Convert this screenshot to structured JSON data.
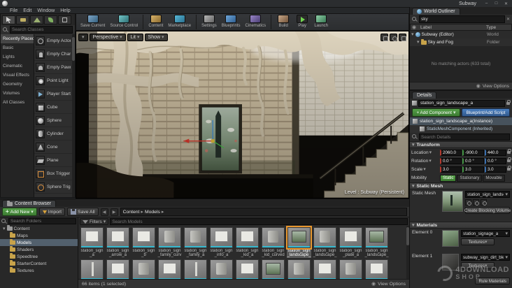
{
  "window": {
    "title": "Subway",
    "menu": [
      "File",
      "Edit",
      "Window",
      "Help"
    ]
  },
  "toolbar": {
    "buttons": [
      "Save Current",
      "Source Control",
      "Content",
      "Marketplace",
      "Settings",
      "Blueprints",
      "Cinematics",
      "Build",
      "Play",
      "Launch"
    ]
  },
  "modes": {
    "search_placeholder": "Search Classes",
    "categories": [
      "Recently Placed",
      "Basic",
      "Lights",
      "Cinematic",
      "Visual Effects",
      "Geometry",
      "Volumes",
      "All Classes"
    ],
    "items": [
      "Empty Actor",
      "Empty Chara",
      "Empty Pawn",
      "Point Light",
      "Player Start",
      "Cube",
      "Sphere",
      "Cylinder",
      "Cone",
      "Plane",
      "Box Trigger",
      "Sphere Trig"
    ]
  },
  "viewport": {
    "camera_mode": "Perspective",
    "view_mode": "Lit",
    "show_menu": "Show",
    "level_label": "Level : Subway (Persistent)"
  },
  "world_outliner": {
    "tab": "World Outliner",
    "search_value": "sky",
    "columns": {
      "label": "Label",
      "type": "Type"
    },
    "rows": [
      {
        "label": "Subway (Editor)",
        "type": "World"
      },
      {
        "label": "Sky and Fog",
        "type": "Folder"
      }
    ],
    "empty_message": "No matching actors (633 total)",
    "view_options": "View Options"
  },
  "details": {
    "tab": "Details",
    "actor_name": "station_sign_landscape_a",
    "add_component": "+ Add Component",
    "blueprint_button": "Blueprint/Add Script",
    "instance_row": "station_sign_landscape_a(Instance)",
    "component_row": "StaticMeshComponent (Inherited)",
    "search_placeholder": "Search Details",
    "transform": {
      "header": "Transform",
      "rows": [
        {
          "label": "Location",
          "x": "2060.0",
          "y": "-900.0",
          "z": "440.0"
        },
        {
          "label": "Rotation",
          "x": "0.0 °",
          "y": "0.0 °",
          "z": "0.0 °"
        },
        {
          "label": "Scale",
          "x": "3.0",
          "y": "3.0",
          "z": "3.0"
        }
      ],
      "mobility_label": "Mobility",
      "mobility": [
        "Static",
        "Stationary",
        "Movable"
      ],
      "mobility_selected": "Static"
    },
    "static_mesh": {
      "header": "Static Mesh",
      "label": "Static Mesh",
      "value": "station_sign_landscape_a",
      "create_blocking_volume": "Create Blocking Volume"
    },
    "materials": {
      "header": "Materials",
      "elements": [
        {
          "label": "Element 0",
          "value": "station_signage_a",
          "textures_button": "Textures"
        },
        {
          "label": "Element 1",
          "value": "subway_sign_dirt_blend",
          "textures_button": "Textures"
        }
      ],
      "rule_materials": "Rule Materials"
    }
  },
  "content_browser": {
    "tab": "Content Browser",
    "add_new": "Add New",
    "import": "Import",
    "save_all": "Save All",
    "breadcrumb": [
      "Content",
      "Models"
    ],
    "folder_search_placeholder": "Search Folders",
    "tree": [
      "Content",
      "Maps",
      "Models",
      "Shaders",
      "Speedtree",
      "StarterContent",
      "Textures"
    ],
    "selected_folder": "Models",
    "filters": "Filters",
    "search_placeholder": "Search Models",
    "assets": [
      "station_sign_a",
      "station_sign_arrow_a",
      "station_sign_b",
      "station_sign_family_curved_a",
      "station_sign_family_a",
      "station_sign_info_a",
      "station_sign_kid_a",
      "station_sign_kid_curved_a",
      "station_sign_landscape_a",
      "station_sign_landscape_curved",
      "station_sign_plate_a",
      "station_sign_landscape_b"
    ],
    "selected_asset": "station_sign_landscape_a",
    "status": "66 items (1 selected)",
    "view_options": "View Options"
  },
  "watermark": {
    "line1": "4DOWNLOAD",
    "line2": "SHOP"
  }
}
